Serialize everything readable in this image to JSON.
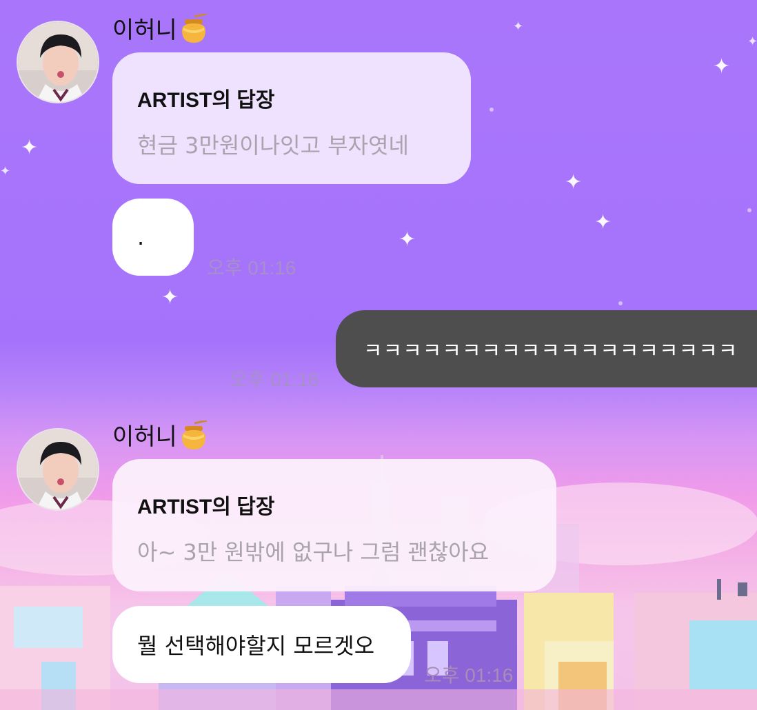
{
  "chat": {
    "messages": [
      {
        "sender": "이허니",
        "reply_title": "ARTIST의 답장",
        "reply_text": "현금 3만원이나잇고 부자엿네",
        "text": ".",
        "time": "오후 01:16"
      },
      {
        "sender": "me",
        "text": "ㅋㅋㅋㅋㅋㅋㅋㅋㅋㅋㅋㅋㅋㅋㅋㅋㅋㅋㅋ",
        "time": "오후 01:16"
      },
      {
        "sender": "이허니",
        "reply_title": "ARTIST의 답장",
        "reply_text": "아~ 3만 원밖에 없구나 그럼 괜찮아요",
        "text": "뭘 선택해야할지 모르겟오",
        "time": "오후 01:16"
      }
    ]
  },
  "icons": {
    "honey": "honey-pot-icon",
    "sparkle": "sparkle-icon"
  },
  "colors": {
    "bg_top": "#a976fb",
    "bg_bottom": "#f3c2e9",
    "my_bubble": "#4e4e4e"
  }
}
